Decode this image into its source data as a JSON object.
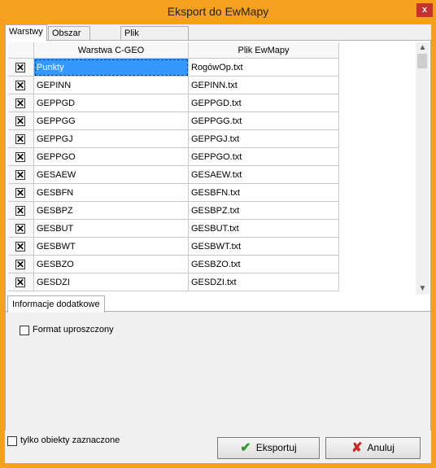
{
  "window": {
    "title": "Eksport do EwMapy",
    "close_label": "x"
  },
  "tabs": [
    {
      "label": "Warstwy"
    },
    {
      "label": "Obszar eksportu"
    },
    {
      "label": "Plik przekodowania"
    }
  ],
  "grid": {
    "columns": [
      "Warstwa C-GEO",
      "Plik EwMapy"
    ],
    "rows": [
      {
        "layer": "Punkty",
        "file": "RogówOp.txt",
        "checked": true,
        "selected": true
      },
      {
        "layer": "GEPINN",
        "file": "GEPINN.txt",
        "checked": true
      },
      {
        "layer": "GEPPGD",
        "file": "GEPPGD.txt",
        "checked": true
      },
      {
        "layer": "GEPPGG",
        "file": "GEPPGG.txt",
        "checked": true
      },
      {
        "layer": "GEPPGJ",
        "file": "GEPPGJ.txt",
        "checked": true
      },
      {
        "layer": "GEPPGO",
        "file": "GEPPGO.txt",
        "checked": true
      },
      {
        "layer": "GESAEW",
        "file": "GESAEW.txt",
        "checked": true
      },
      {
        "layer": "GESBFN",
        "file": "GESBFN.txt",
        "checked": true
      },
      {
        "layer": "GESBPZ",
        "file": "GESBPZ.txt",
        "checked": true
      },
      {
        "layer": "GESBUT",
        "file": "GESBUT.txt",
        "checked": true
      },
      {
        "layer": "GESBWT",
        "file": "GESBWT.txt",
        "checked": true
      },
      {
        "layer": "GESBZO",
        "file": "GESBZO.txt",
        "checked": true
      },
      {
        "layer": "GESDZI",
        "file": "GESDZI.txt",
        "checked": true
      }
    ],
    "checked_mark": "✕"
  },
  "info": {
    "tab_label": "Informacje dodatkowe",
    "format_label": "Format uproszczony"
  },
  "footer": {
    "only_selected_label": "tylko obiekty zaznaczone",
    "export_label": "Eksportuj",
    "cancel_label": "Anuluj"
  },
  "colors": {
    "titlebar": "#f5a01f",
    "close": "#c7322f",
    "selection": "#3399ff",
    "export_icon": "#2e9b2e",
    "cancel_icon": "#c82828"
  }
}
